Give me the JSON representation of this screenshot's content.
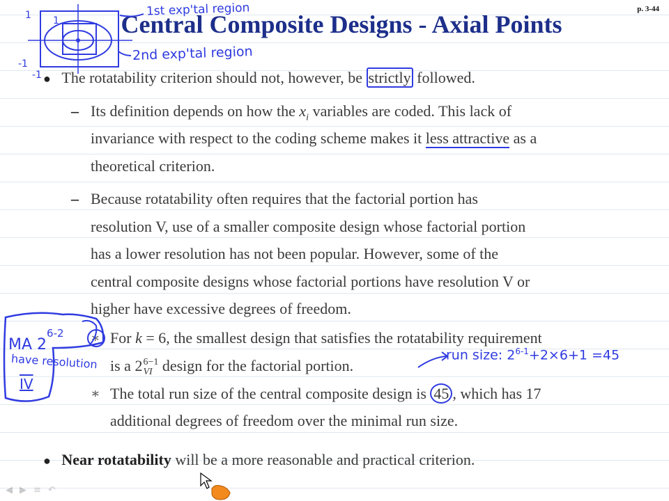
{
  "page": {
    "number": "p. 3-44"
  },
  "title": "Central Composite Designs - Axial Points",
  "bullets": [
    {
      "pre": "The rotatability criterion should not, however, be ",
      "highlight": "strictly",
      "post": " followed."
    }
  ],
  "sub1": {
    "l1_pre": "Its definition depends on how the ",
    "var": "x",
    "var_sub": "i",
    "l1_post": " variables are coded. This lack of",
    "l2_pre": "invariance with respect to the coding scheme makes it ",
    "l2_underline": "less attractive",
    "l2_post": " as a",
    "l3": "theoretical criterion."
  },
  "sub2": {
    "l1": "Because rotatability often requires that the factorial portion has",
    "l2": "resolution V, use of a smaller composite design whose factorial portion",
    "l3": "has a lower resolution has not been popular. However, some of the",
    "l4": "central composite designs whose factorial portions have resolution V or",
    "l5": "higher have excessive degrees of freedom."
  },
  "star1": {
    "l1_pre": "For ",
    "k": "k",
    "l1_post": " = 6, the smallest design that satisfies the rotatability requirement",
    "l2_pre": "is a 2",
    "exp": "6−1",
    "res": "VI",
    "l2_post": " design for the factorial portion."
  },
  "star2": {
    "l1_pre": "The total run size of the central composite design is ",
    "circled": "45",
    "l1_post": ", which has 17",
    "l2": "additional degrees of freedom over the minimal run size."
  },
  "bullet2": {
    "bold": "Near rotatability",
    "rest": " will be a more reasonable and practical criterion."
  },
  "annotations": {
    "first_region": "1st exp'tal region",
    "second_region": "2nd exp'tal region",
    "minus_one_a": "-1",
    "minus_one_b": "-1",
    "one_a": "1",
    "one_b": "1",
    "ma_prefix": "MA 2",
    "ma_exp": "6-2",
    "have_resolution": "have resolution",
    "resolution_iv": "IV",
    "run_size": "run size: 2",
    "run_size_exp": "6-1",
    "run_size_rest": "+2×6+1 =45"
  },
  "colors": {
    "title": "#1d2f8a",
    "ink": "#2f3be0",
    "text": "#3a3a3a"
  },
  "icons": [
    "nav-arrow-left-icon",
    "nav-arrow-right-icon",
    "menu-icon",
    "hand-cursor-icon"
  ]
}
